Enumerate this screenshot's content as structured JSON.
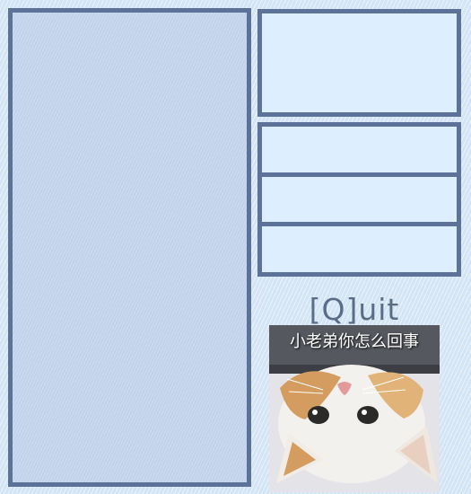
{
  "menu": {
    "quit_label": "[Q]uit"
  },
  "meme": {
    "caption": "小老弟你怎么回事"
  },
  "colors": {
    "border": "#5d7299",
    "panel_fill": "#dceeff",
    "main_fill": "#c0d3ea",
    "background": "#d3e5f5",
    "quit_text": "#5a6d86"
  }
}
